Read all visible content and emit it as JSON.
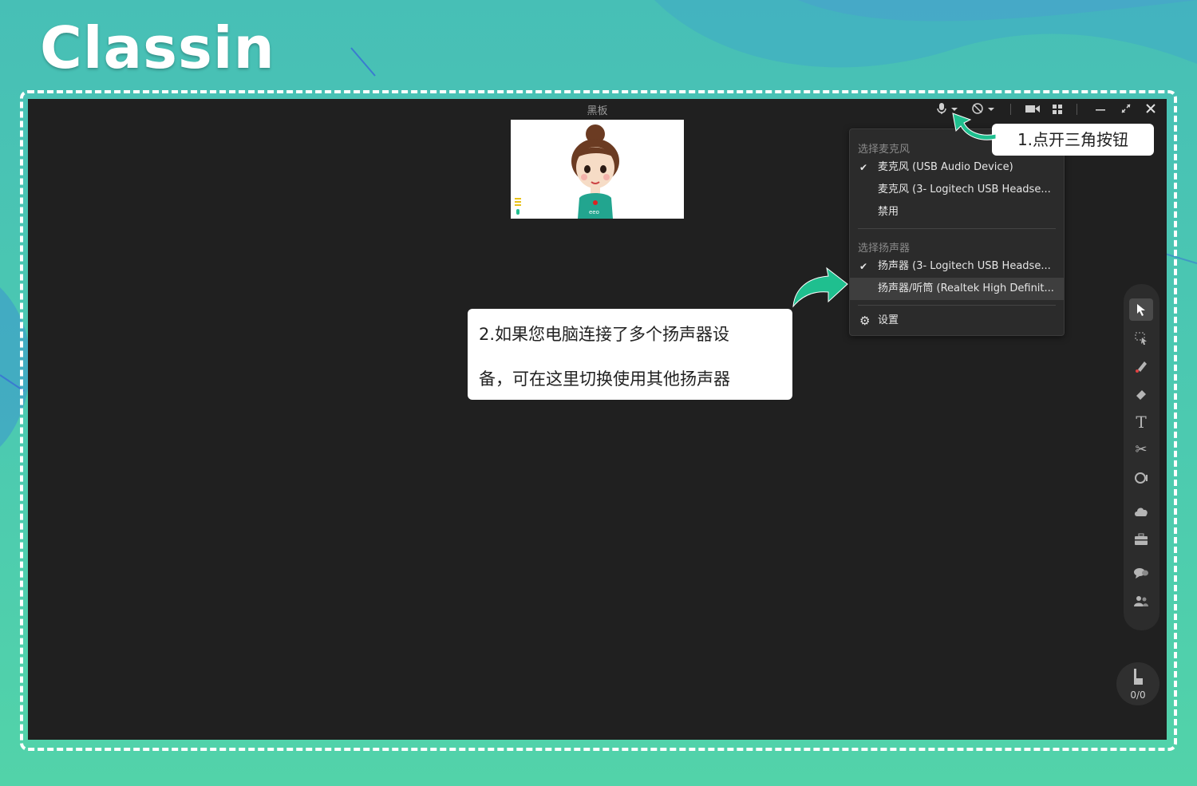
{
  "brand": {
    "logo_text": "Classin"
  },
  "window": {
    "title": "黑板"
  },
  "titlebar_icons": [
    "microphone-icon",
    "caret-down-icon",
    "microphone-off-icon",
    "caret-down-icon",
    "camera-icon",
    "grid-icon",
    "minimize-icon",
    "maximize-icon",
    "close-icon"
  ],
  "mic_menu": {
    "mic_header": "选择麦克风",
    "mic_options": [
      {
        "label": "麦克风 (USB Audio Device)",
        "checked": true
      },
      {
        "label": "麦克风 (3- Logitech USB Headse...",
        "checked": false
      },
      {
        "label": "禁用",
        "checked": false
      }
    ],
    "speaker_header": "选择扬声器",
    "speaker_options": [
      {
        "label": "扬声器 (3- Logitech USB Headse...",
        "checked": true
      },
      {
        "label": "扬声器/听筒 (Realtek High Definit...",
        "checked": false,
        "highlighted": true
      }
    ],
    "settings_label": "设置"
  },
  "callouts": {
    "step1": "1.点开三角按钮",
    "step2_line1": "2.如果您电脑连接了多个扬声器设",
    "step2_line2": "备，可在这里切换使用其他扬声器"
  },
  "toolbar": {
    "tools": [
      "select-tool",
      "area-select-tool",
      "laser-pointer-tool",
      "eraser-tool",
      "text-tool",
      "scissors-tool",
      "shape-tool",
      "cloud-tool",
      "toolbox-tool",
      "chat-tool",
      "members-tool"
    ]
  },
  "hand_raise": {
    "count": "0/0"
  },
  "colors": {
    "accent_green": "#1fbf8f",
    "app_bg": "#202020",
    "menu_bg": "#2b2b2b"
  }
}
